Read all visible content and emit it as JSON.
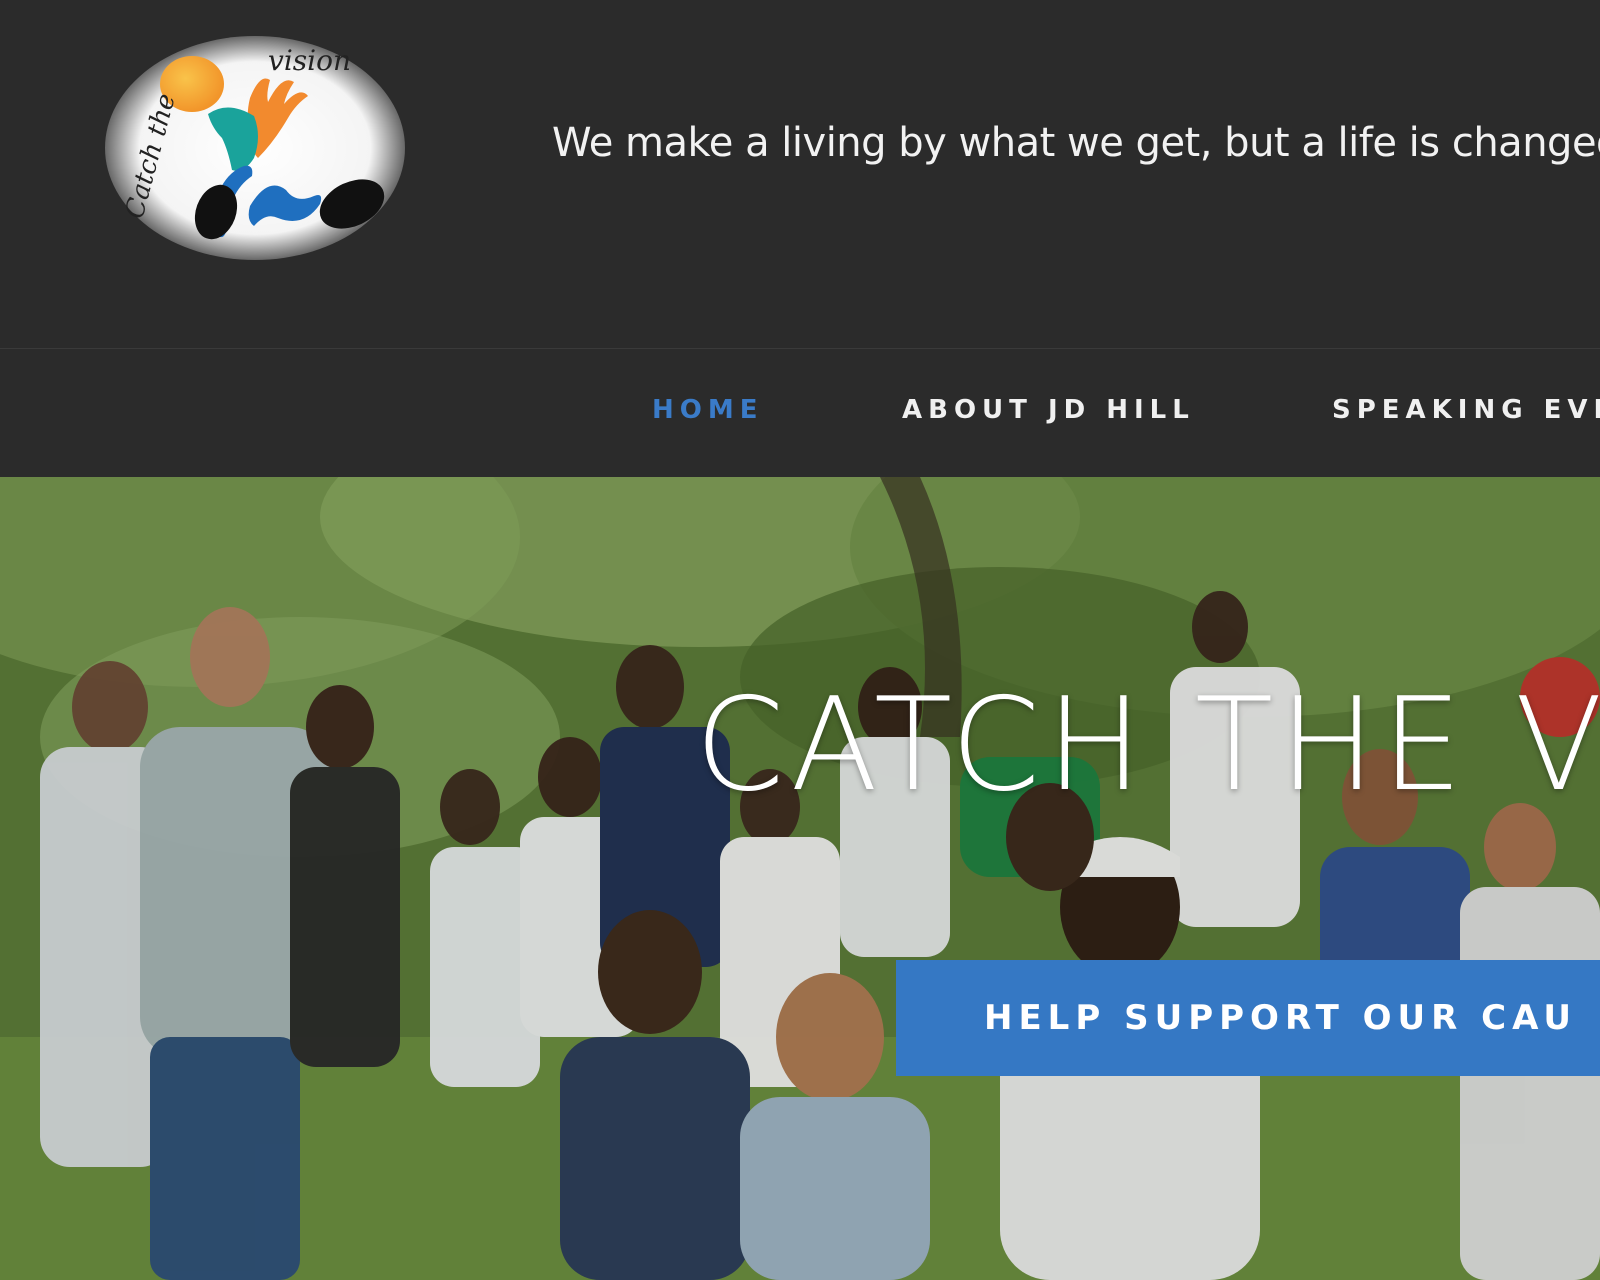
{
  "header": {
    "logo": {
      "text_top": "vision",
      "text_side": "Catch the"
    },
    "tagline": "We make a living by what we get, but a life is changed"
  },
  "nav": {
    "items": [
      {
        "label": "HOME",
        "active": true
      },
      {
        "label": "ABOUT JD HILL",
        "active": false
      },
      {
        "label": "SPEAKING EVE",
        "active": false
      }
    ]
  },
  "hero": {
    "title": "CATCH THE V",
    "cta_label": "HELP SUPPORT OUR CAU",
    "image_description_icon": "group-photo"
  },
  "colors": {
    "accent": "#3578c4",
    "nav_active": "#3a7bc8",
    "header_bg": "#2b2b2b"
  }
}
